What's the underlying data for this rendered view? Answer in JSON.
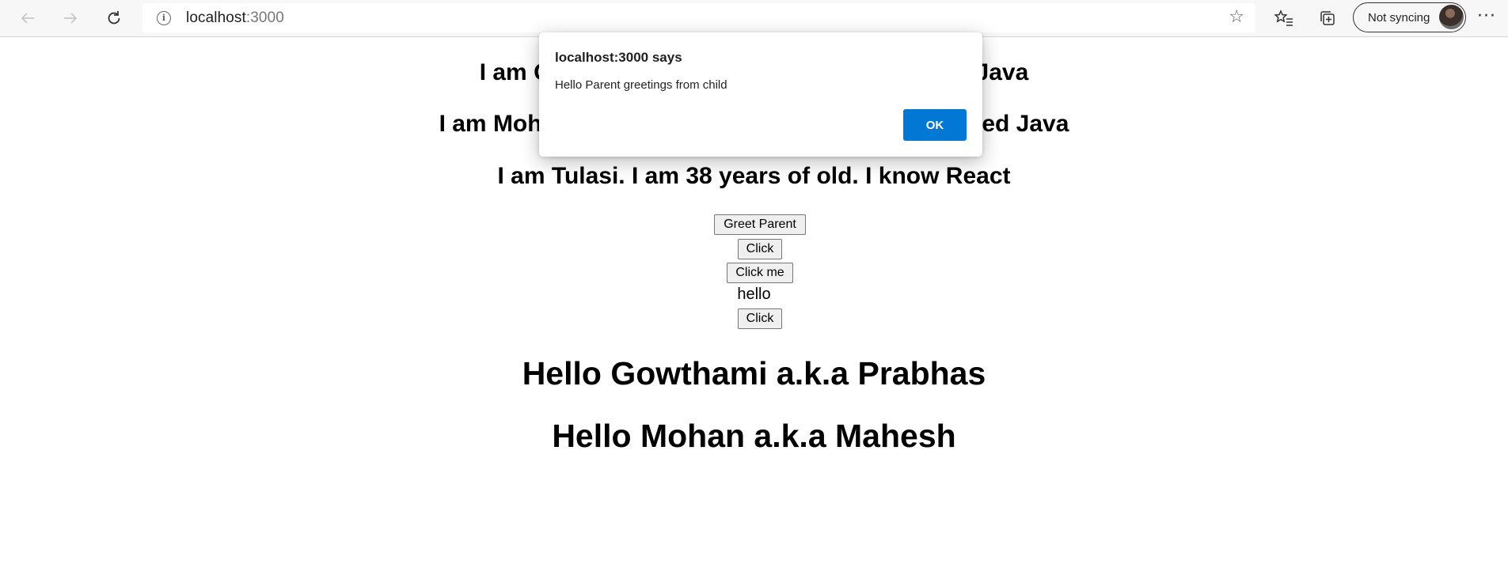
{
  "browser": {
    "url_host": "localhost",
    "url_port": ":3000",
    "sync_label": "Not syncing",
    "icons": {
      "back": "back-arrow-icon",
      "forward": "forward-arrow-icon",
      "refresh": "refresh-icon",
      "info": "info-icon",
      "favorite": "star-icon",
      "favorites": "favorites-list-icon",
      "collections": "collections-icon",
      "more": "more-icon"
    }
  },
  "page": {
    "intros": [
      "I am Gowthami. I am 22 years of old. I know Java",
      "I am Mohan. I am 28 years of old. I know Advanced Java",
      "I am Tulasi. I am 38 years of old. I know React"
    ],
    "buttons": {
      "greet_parent": "Greet Parent",
      "click_1": "Click",
      "click_me": "Click me",
      "click_2": "Click"
    },
    "hello_text": "hello",
    "greetings": [
      "Hello Gowthami a.k.a Prabhas",
      "Hello Mohan a.k.a Mahesh"
    ]
  },
  "dialog": {
    "title": "localhost:3000 says",
    "message": "Hello Parent greetings from child",
    "ok_label": "OK",
    "accent_color": "#0078d4"
  }
}
